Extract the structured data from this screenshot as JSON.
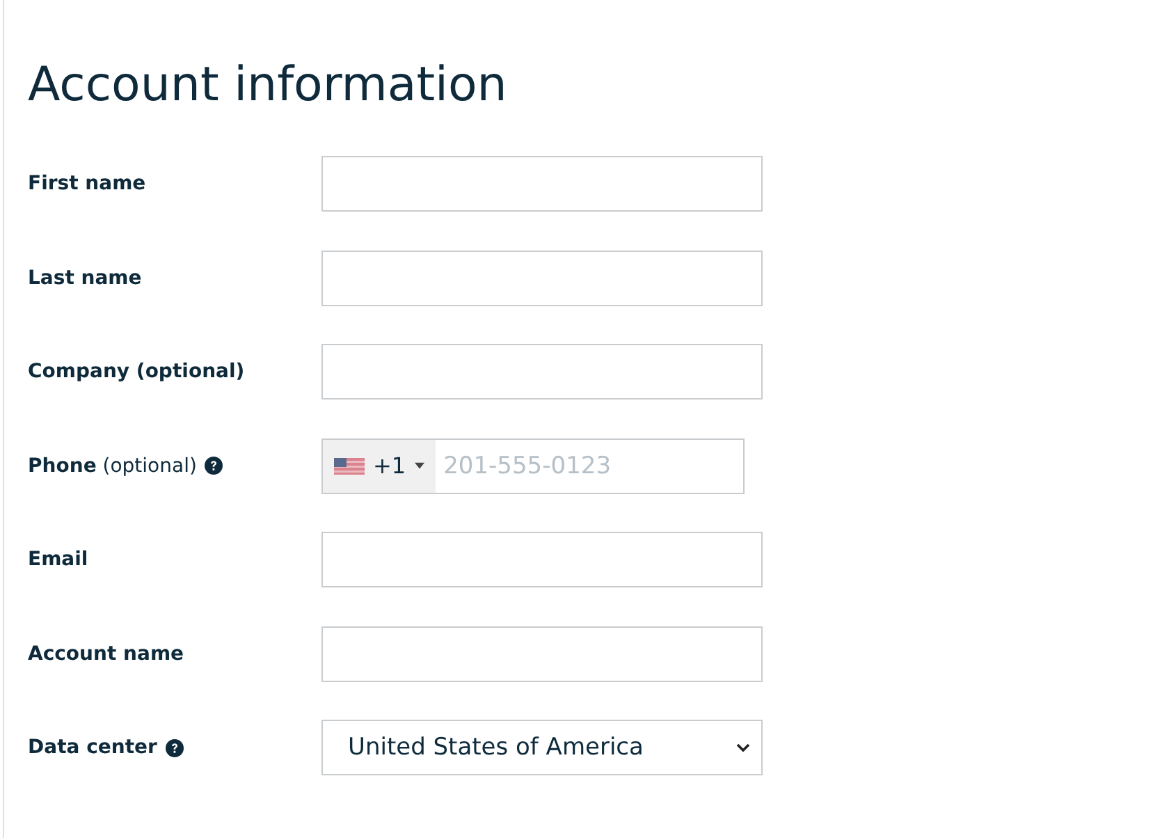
{
  "title": "Account information",
  "fields": [
    {
      "kind": "text",
      "label": "**First name**",
      "help": false
    },
    {
      "kind": "text",
      "label": "**Last name**",
      "help": false
    },
    {
      "kind": "text",
      "label": "**Company (optional)**",
      "help": false
    },
    {
      "kind": "phone",
      "label": "**Phone** (optional)",
      "help": true,
      "dial_code": "+1",
      "placeholder": "201-555-0123"
    },
    {
      "kind": "text",
      "label": "**Email**",
      "help": false
    },
    {
      "kind": "text",
      "label": "**Account name**",
      "help": false
    },
    {
      "kind": "select",
      "label": "**Data center**",
      "help": true,
      "value": "United States of America"
    }
  ]
}
